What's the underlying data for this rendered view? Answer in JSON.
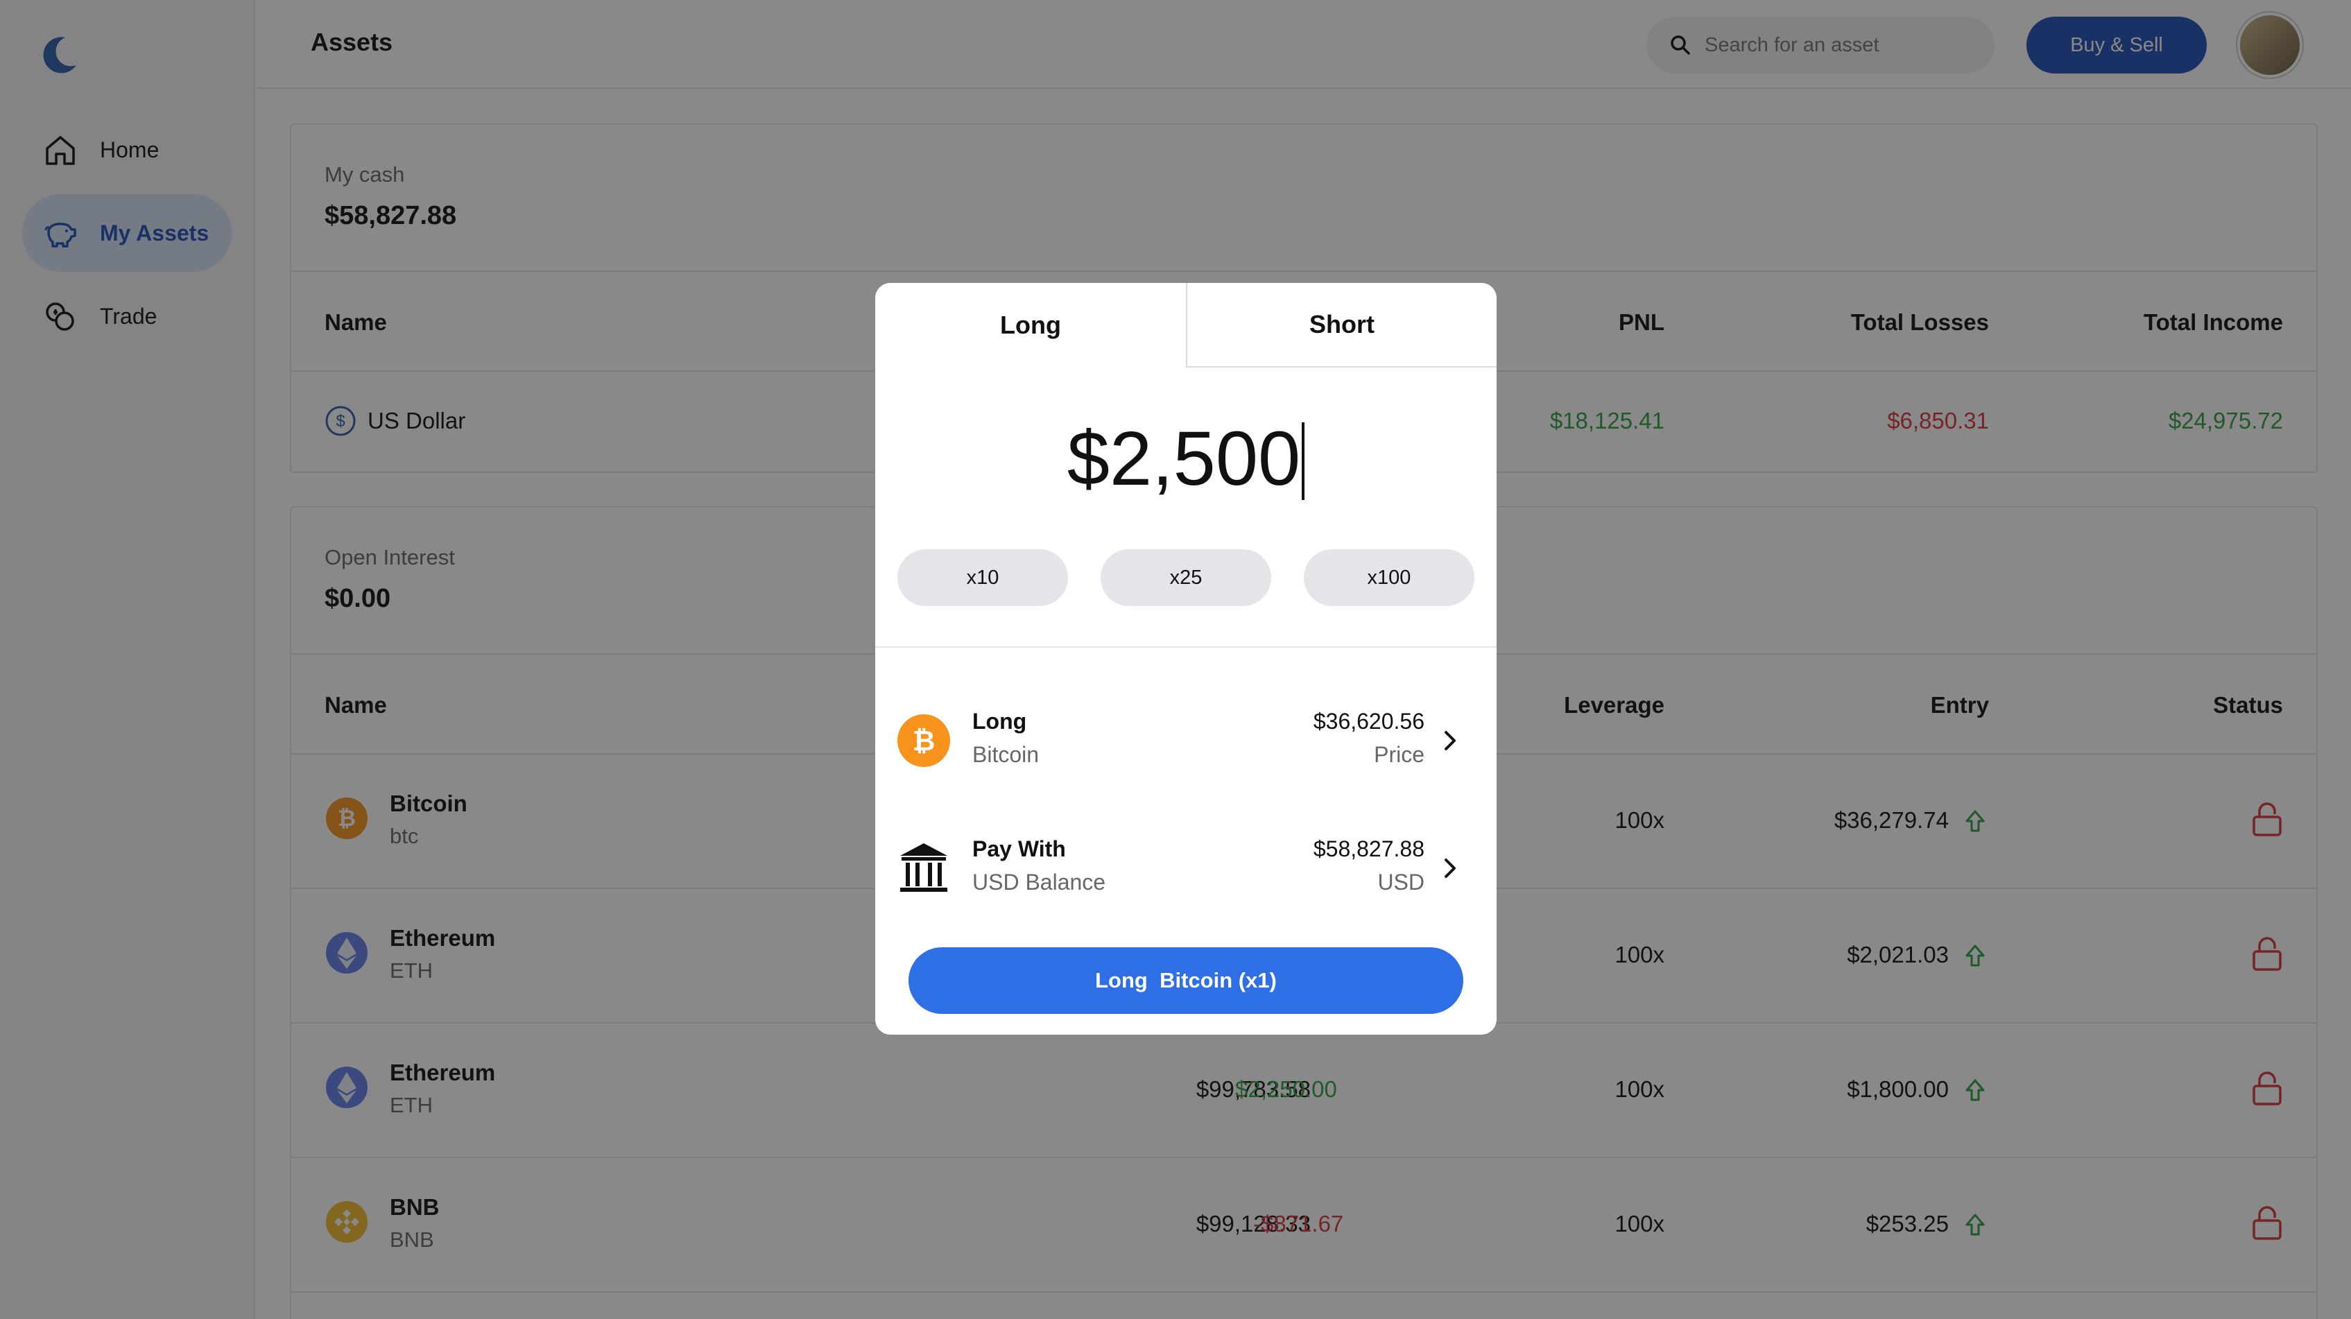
{
  "sidebar": {
    "logo_icon": "moon-icon",
    "items": [
      {
        "label": "Home",
        "icon": "home-icon",
        "active": false
      },
      {
        "label": "My Assets",
        "icon": "piggy-bank-icon",
        "active": true
      },
      {
        "label": "Trade",
        "icon": "coins-icon",
        "active": false
      }
    ]
  },
  "header": {
    "title": "Assets",
    "search_placeholder": "Search for an asset",
    "buy_sell_label": "Buy & Sell"
  },
  "cash_card": {
    "label": "My cash",
    "value": "$58,827.88",
    "columns": [
      "Name",
      "PNL",
      "Total Losses",
      "Total Income"
    ],
    "row": {
      "name": "US Dollar",
      "pnl": "$18,125.41",
      "losses": "$6,850.31",
      "income": "$24,975.72"
    }
  },
  "interest_card": {
    "label": "Open Interest",
    "value": "$0.00",
    "columns": [
      "Name",
      "Leverage",
      "Entry",
      "Status"
    ],
    "rows": [
      {
        "name": "Bitcoin",
        "symbol": "btc",
        "value": "",
        "pnl": "",
        "leverage": "100x",
        "entry": "$36,279.74"
      },
      {
        "name": "Ethereum",
        "symbol": "ETH",
        "value": "",
        "pnl": "",
        "leverage": "100x",
        "entry": "$2,021.03"
      },
      {
        "name": "Ethereum",
        "symbol": "ETH",
        "value": "$99,783.58",
        "pnl": "$2,250.00",
        "leverage": "100x",
        "entry": "$1,800.00"
      },
      {
        "name": "BNB",
        "symbol": "BNB",
        "value": "$99,128.33",
        "pnl": "-$871.67",
        "leverage": "100x",
        "entry": "$253.25"
      }
    ]
  },
  "modal": {
    "tabs": [
      "Long",
      "Short"
    ],
    "active_tab": "Long",
    "amount": "$2,500",
    "leverage_options": [
      "x10",
      "x25",
      "x100"
    ],
    "asset_row": {
      "title": "Long",
      "subtitle": "Bitcoin",
      "value": "$36,620.56",
      "unit": "Price"
    },
    "pay_row": {
      "title": "Pay With",
      "subtitle": "USD Balance",
      "value": "$58,827.88",
      "unit": "USD"
    },
    "cta_label": "Long  Bitcoin (x1)"
  },
  "colors": {
    "accent": "#1f4fb5",
    "cta": "#2f6fe6",
    "positive": "#2e9e3f",
    "negative": "#d8373a"
  }
}
